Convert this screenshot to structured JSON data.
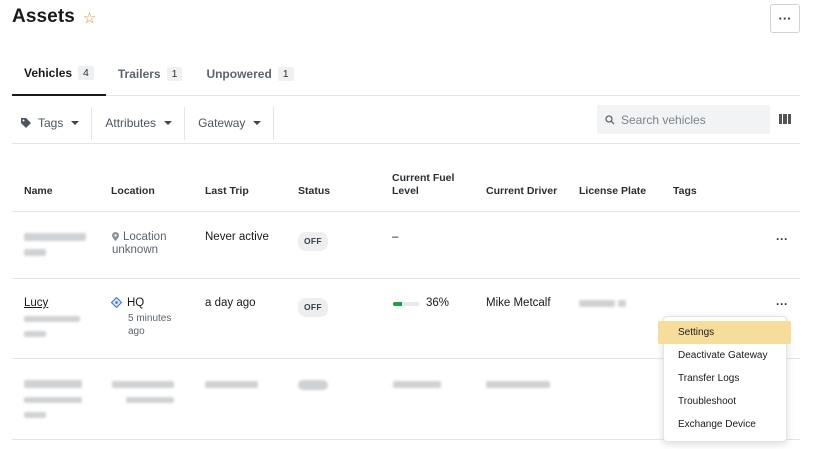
{
  "page": {
    "title": "Assets",
    "more_label": "···"
  },
  "tabs": [
    {
      "label": "Vehicles",
      "count": "4",
      "active": true
    },
    {
      "label": "Trailers",
      "count": "1"
    },
    {
      "label": "Unpowered",
      "count": "1"
    }
  ],
  "filters": {
    "tags": "Tags",
    "attributes": "Attributes",
    "gateway": "Gateway",
    "search_placeholder": "Search vehicles"
  },
  "table": {
    "headers": {
      "name": "Name",
      "location": "Location",
      "last_trip": "Last Trip",
      "status": "Status",
      "fuel": "Current Fuel Level",
      "driver": "Current Driver",
      "plate": "License Plate",
      "tags": "Tags"
    },
    "rows": [
      {
        "name": "",
        "location": "Location unknown",
        "last_trip": "Never active",
        "status": "OFF",
        "fuel": "–",
        "driver": "",
        "plate": ""
      },
      {
        "name": "Lucy",
        "location": "HQ",
        "location_time": "5 minutes ago",
        "last_trip": "a day ago",
        "status": "OFF",
        "fuel_percent_label": "36%",
        "fuel_percent": 36,
        "driver": "Mike Metcalf",
        "plate": ""
      }
    ],
    "row_more_label": "···"
  },
  "context_menu": {
    "items": [
      "Settings",
      "Deactivate Gateway",
      "Transfer Logs",
      "Troubleshoot",
      "Exchange Device"
    ],
    "highlighted": "Settings"
  },
  "colors": {
    "accent_star": "#e8892b",
    "fuel_fill": "#19a04a",
    "menu_highlight": "#f7dd9c"
  },
  "icons": [
    "star-icon",
    "tag-icon",
    "search-icon",
    "columns-icon",
    "location-pin-icon",
    "hq-geofence-icon",
    "more-icon"
  ]
}
